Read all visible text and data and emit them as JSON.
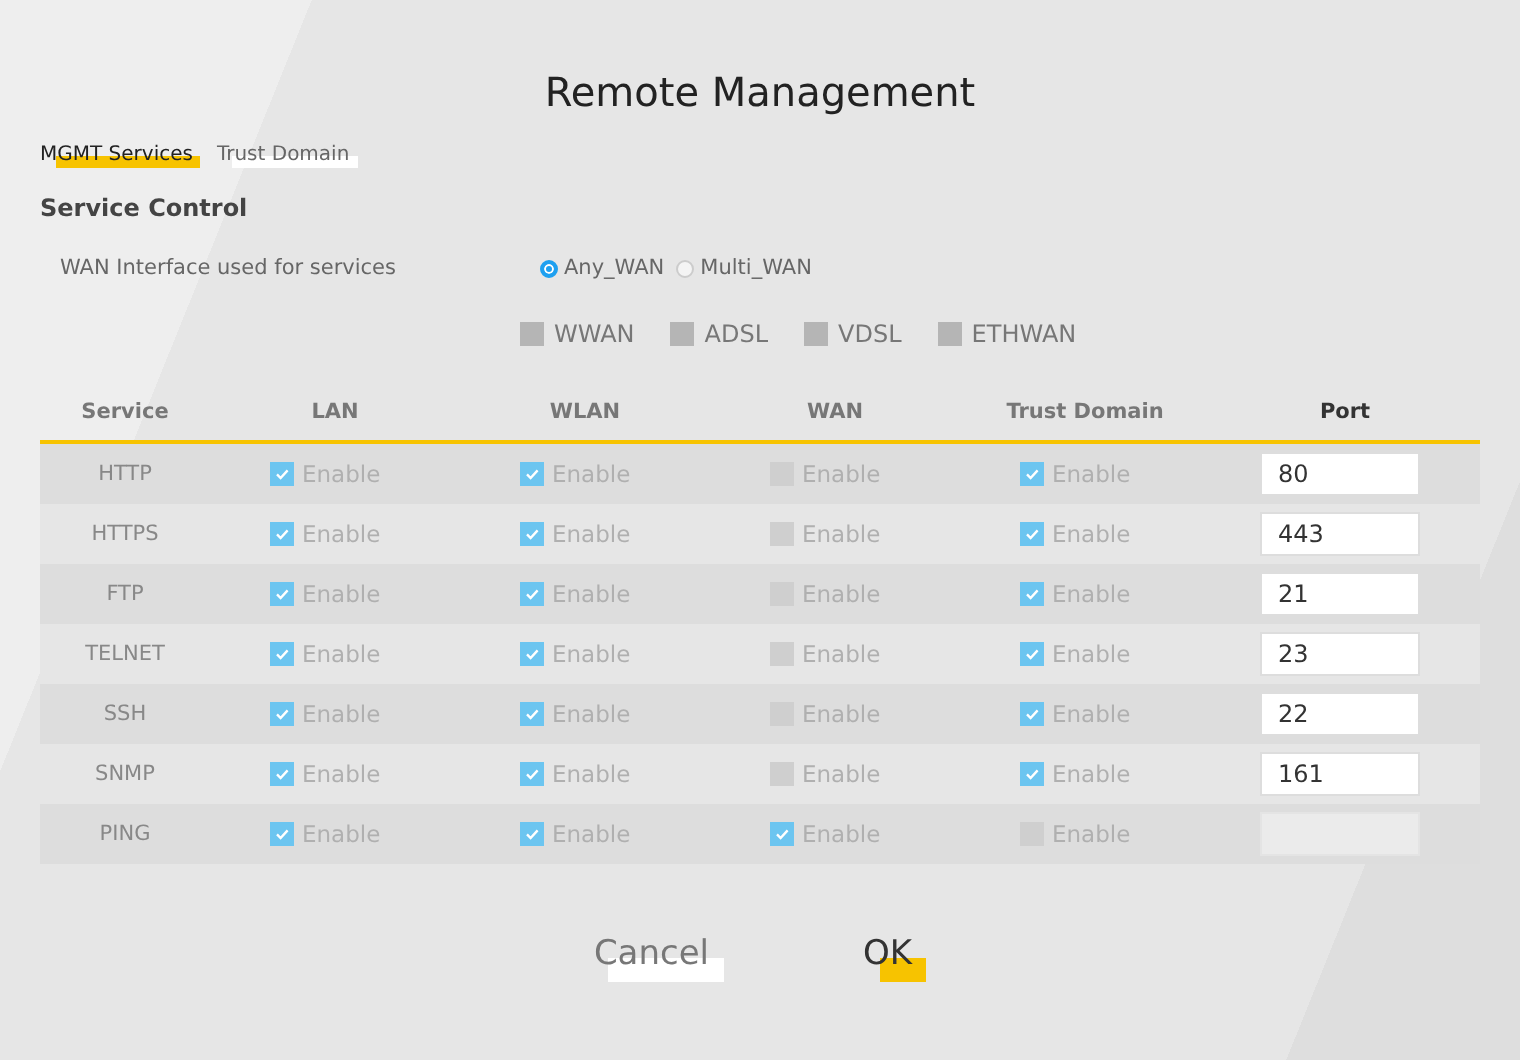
{
  "title": "Remote Management",
  "tabs": [
    {
      "label": "MGMT Services",
      "selected": true
    },
    {
      "label": "Trust Domain",
      "selected": false
    }
  ],
  "section_title": "Service Control",
  "wan_interface": {
    "label": "WAN Interface used for services",
    "options": [
      {
        "label": "Any_WAN",
        "selected": true
      },
      {
        "label": "Multi_WAN",
        "selected": false
      }
    ]
  },
  "interfaces": [
    {
      "label": "WWAN",
      "checked": false
    },
    {
      "label": "ADSL",
      "checked": false
    },
    {
      "label": "VDSL",
      "checked": false
    },
    {
      "label": "ETHWAN",
      "checked": false
    }
  ],
  "table": {
    "columns": [
      "Service",
      "LAN",
      "WLAN",
      "WAN",
      "Trust Domain",
      "Port"
    ],
    "rows": [
      {
        "cells": [
          {
            "kind": "text",
            "text": "HTTP"
          },
          {
            "kind": "checkbox",
            "label": "Enable",
            "checked": true
          },
          {
            "kind": "checkbox",
            "label": "Enable",
            "checked": true
          },
          {
            "kind": "checkbox",
            "label": "Enable",
            "checked": false
          },
          {
            "kind": "checkbox",
            "label": "Enable",
            "checked": true
          },
          {
            "kind": "port",
            "value": "80",
            "disabled": false
          }
        ]
      },
      {
        "cells": [
          {
            "kind": "text",
            "text": "HTTPS"
          },
          {
            "kind": "checkbox",
            "label": "Enable",
            "checked": true
          },
          {
            "kind": "checkbox",
            "label": "Enable",
            "checked": true
          },
          {
            "kind": "checkbox",
            "label": "Enable",
            "checked": false
          },
          {
            "kind": "checkbox",
            "label": "Enable",
            "checked": true
          },
          {
            "kind": "port",
            "value": "443",
            "disabled": false
          }
        ]
      },
      {
        "cells": [
          {
            "kind": "text",
            "text": "FTP"
          },
          {
            "kind": "checkbox",
            "label": "Enable",
            "checked": true
          },
          {
            "kind": "checkbox",
            "label": "Enable",
            "checked": true
          },
          {
            "kind": "checkbox",
            "label": "Enable",
            "checked": false
          },
          {
            "kind": "checkbox",
            "label": "Enable",
            "checked": true
          },
          {
            "kind": "port",
            "value": "21",
            "disabled": false
          }
        ]
      },
      {
        "cells": [
          {
            "kind": "text",
            "text": "TELNET"
          },
          {
            "kind": "checkbox",
            "label": "Enable",
            "checked": true
          },
          {
            "kind": "checkbox",
            "label": "Enable",
            "checked": true
          },
          {
            "kind": "checkbox",
            "label": "Enable",
            "checked": false
          },
          {
            "kind": "checkbox",
            "label": "Enable",
            "checked": true
          },
          {
            "kind": "port",
            "value": "23",
            "disabled": false
          }
        ]
      },
      {
        "cells": [
          {
            "kind": "text",
            "text": "SSH"
          },
          {
            "kind": "checkbox",
            "label": "Enable",
            "checked": true
          },
          {
            "kind": "checkbox",
            "label": "Enable",
            "checked": true
          },
          {
            "kind": "checkbox",
            "label": "Enable",
            "checked": false
          },
          {
            "kind": "checkbox",
            "label": "Enable",
            "checked": true
          },
          {
            "kind": "port",
            "value": "22",
            "disabled": false
          }
        ]
      },
      {
        "cells": [
          {
            "kind": "text",
            "text": "SNMP"
          },
          {
            "kind": "checkbox",
            "label": "Enable",
            "checked": true
          },
          {
            "kind": "checkbox",
            "label": "Enable",
            "checked": true
          },
          {
            "kind": "checkbox",
            "label": "Enable",
            "checked": false
          },
          {
            "kind": "checkbox",
            "label": "Enable",
            "checked": true
          },
          {
            "kind": "port",
            "value": "161",
            "disabled": false
          }
        ]
      },
      {
        "cells": [
          {
            "kind": "text",
            "text": "PING"
          },
          {
            "kind": "checkbox",
            "label": "Enable",
            "checked": true
          },
          {
            "kind": "checkbox",
            "label": "Enable",
            "checked": true
          },
          {
            "kind": "checkbox",
            "label": "Enable",
            "checked": true
          },
          {
            "kind": "checkbox",
            "label": "Enable",
            "checked": false
          },
          {
            "kind": "port",
            "disabled": true
          }
        ]
      }
    ]
  },
  "buttons": [
    {
      "label": "Cancel",
      "kind": "secondary"
    },
    {
      "label": "OK",
      "kind": "primary"
    }
  ]
}
